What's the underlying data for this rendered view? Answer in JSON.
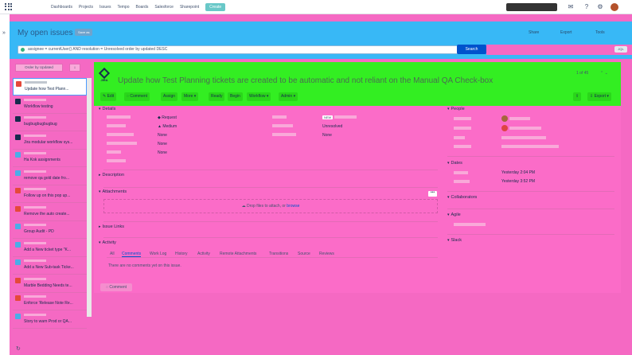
{
  "topnav": {
    "items": [
      "Dashboards",
      "Projects",
      "Issues",
      "Tempo",
      "Boards",
      "Salesforce",
      "Sharepoint"
    ],
    "create_label": "Create"
  },
  "header": {
    "title": "My open issues",
    "save_as": "Save as",
    "share": "Share",
    "export": "Export",
    "tools": "Tools",
    "jql": "assignee = currentUser() AND resolution = Unresolved order by updated DESC",
    "search_label": "Search",
    "toggle": "JQL"
  },
  "list": {
    "order_by": "Order by Updated",
    "sort_icon": "↓",
    "items": [
      {
        "summary": "Update how Test Plann...",
        "icon": "bug",
        "selected": true
      },
      {
        "summary": "Workflow testing",
        "icon": "task",
        "selected": false
      },
      {
        "summary": "bugbugbugbugbug",
        "icon": "task",
        "selected": false
      },
      {
        "summary": "Jira modular workflow sys...",
        "icon": "task",
        "selected": false
      },
      {
        "summary": "Ha Kok assignments",
        "icon": "check",
        "selected": false
      },
      {
        "summary": "remove qa gold date fro...",
        "icon": "check",
        "selected": false
      },
      {
        "summary": "Follow up on this pop up...",
        "icon": "bug",
        "selected": false
      },
      {
        "summary": "Remove the auto create...",
        "icon": "bug",
        "selected": false
      },
      {
        "summary": "Group Audit - PD",
        "icon": "check",
        "selected": false
      },
      {
        "summary": "Add a New ticket type \"K...",
        "icon": "check",
        "selected": false
      },
      {
        "summary": "Add a New Sub-task Ticke...",
        "icon": "check",
        "selected": false
      },
      {
        "summary": "Marble Bedding Needs te...",
        "icon": "bug",
        "selected": false
      },
      {
        "summary": "Enforce 'Release Note Re...",
        "icon": "bug",
        "selected": false
      },
      {
        "summary": "Story to warn Prod or QA...",
        "icon": "check",
        "selected": false
      }
    ]
  },
  "issue": {
    "jira_text": "JIRA",
    "title": "Update how Test Planning tickets are created to be automatic and not reliant on the Manual QA Check-box",
    "count": "1 of 45",
    "toolbar": [
      "Edit",
      "Comment",
      "Assign",
      "More",
      "Ready",
      "Begin",
      "Workflow",
      "Admin"
    ],
    "export": "Export",
    "details": {
      "heading": "Details",
      "type_value": "Request",
      "priority_value": "Medium",
      "affects_value": "None",
      "components_value": "None",
      "labels_value": "None",
      "status_badge": "NEW",
      "resolution_value": "Unresolved",
      "fix_value": "None"
    },
    "description_heading": "Description",
    "attachments_heading": "Attachments",
    "drop_text": "Drop files to attach, or",
    "browse_text": "browse",
    "more_dots": "•••",
    "issue_links_heading": "Issue Links",
    "activity_heading": "Activity",
    "tabs": [
      "All",
      "Comments",
      "Work Log",
      "History",
      "Activity",
      "Remote Attachments",
      "Transitions",
      "Source",
      "Reviews"
    ],
    "no_comments": "There are no comments yet on this issue.",
    "comment_btn": "Comment",
    "people_heading": "People",
    "dates_heading": "Dates",
    "created_value": "Yesterday 2:04 PM",
    "updated_value": "Yesterday 3:52 PM",
    "collaborators_heading": "Collaborators",
    "agile_heading": "Agile",
    "slack_heading": "Slack"
  }
}
